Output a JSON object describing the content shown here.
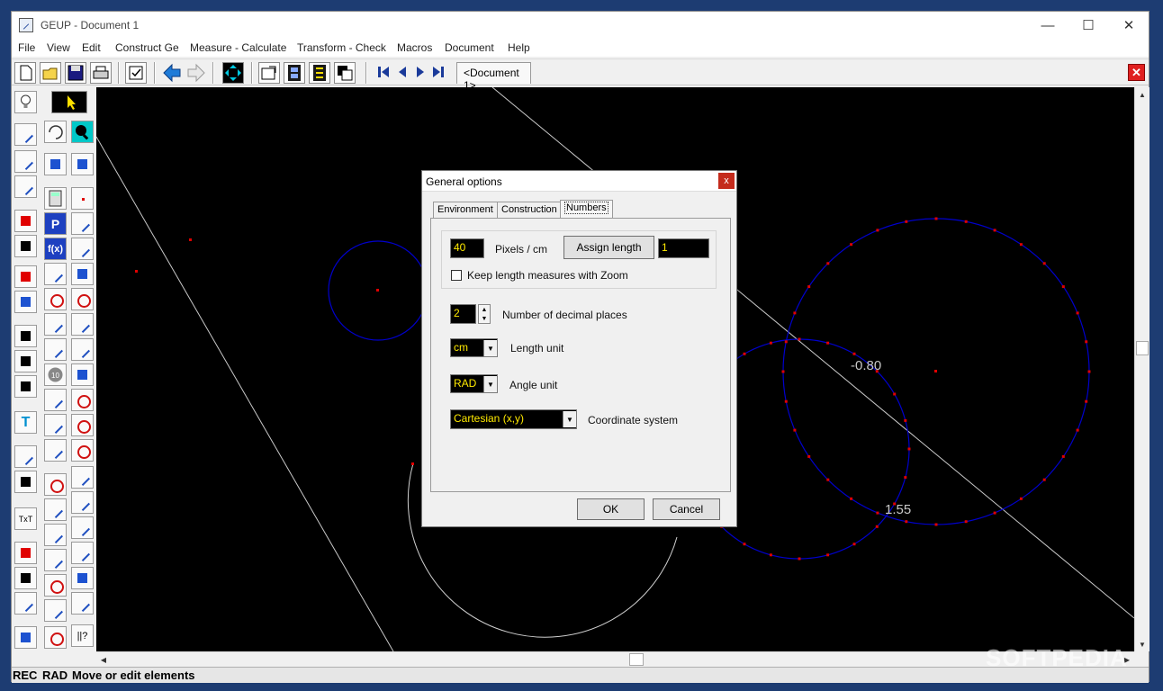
{
  "window": {
    "title": "GEUP - Document 1",
    "minimize_glyph": "—",
    "maximize_glyph": "☐",
    "close_glyph": "✕"
  },
  "menu": [
    "File",
    "View",
    "Edit",
    "Construct Ge",
    "Measure - Calculate",
    "Transform - Check",
    "Macros",
    "Document",
    "Help"
  ],
  "toolbar": {
    "document_tab": "<Document 1>",
    "close_doc_glyph": "✕",
    "icons": [
      "new-icon",
      "open-icon",
      "save-icon",
      "print-icon",
      "checklist-icon",
      "back-arrow-icon",
      "forward-arrow-icon",
      "fit-view-icon",
      "window-icon",
      "film-icon",
      "macro-film-icon",
      "duplicate-icon",
      "first-icon",
      "prev-icon",
      "next-icon",
      "last-icon"
    ]
  },
  "canvas": {
    "labels": [
      {
        "text": "-0.80"
      },
      {
        "text": "1.55"
      }
    ],
    "colors": {
      "background": "#000000",
      "circle": "#0000cc",
      "point": "#e00000",
      "line": "#c8c8c8"
    }
  },
  "dialog": {
    "title": "General options",
    "close_glyph": "x",
    "tabs": [
      "Environment",
      "Construction",
      "Numbers"
    ],
    "active_tab": "Numbers",
    "pixels_per_cm": {
      "value": "40",
      "label": "Pixels / cm"
    },
    "assign_length": {
      "button": "Assign length",
      "value": "1"
    },
    "keep_zoom": {
      "label": "Keep length measures with Zoom",
      "checked": false
    },
    "decimal_places": {
      "value": "2",
      "label": "Number of decimal places"
    },
    "length_unit": {
      "value": "cm",
      "label": "Length unit"
    },
    "angle_unit": {
      "value": "RAD",
      "label": "Angle unit"
    },
    "coordinate_system": {
      "value": "Cartesian (x,y)",
      "label": "Coordinate system"
    },
    "ok": "OK",
    "cancel": "Cancel"
  },
  "status": {
    "rec": "REC",
    "angle": "RAD",
    "message": "Move or edit elements"
  },
  "watermark": "SOFTPEDIA"
}
